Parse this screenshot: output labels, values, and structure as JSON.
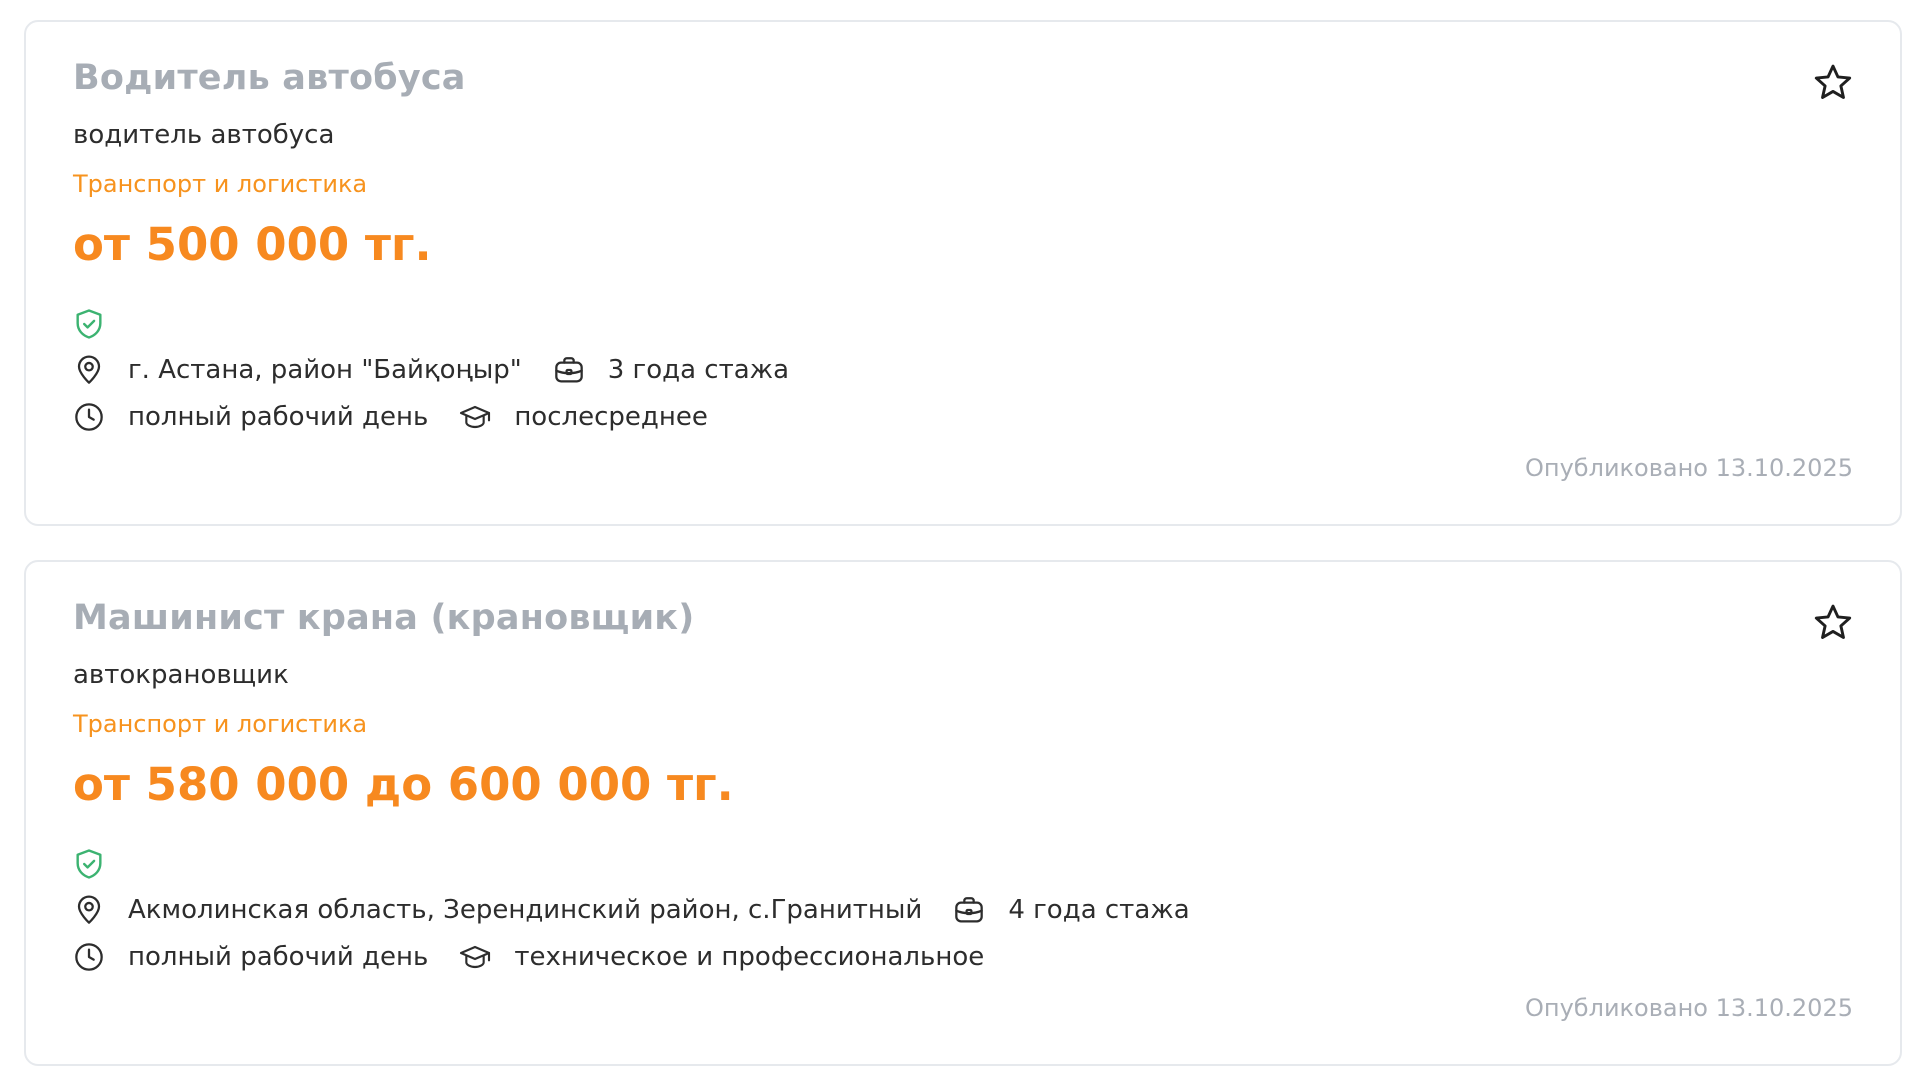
{
  "vacancies": [
    {
      "title": "Водитель автобуса",
      "subtitle": "водитель автобуса",
      "category": "Транспорт и логистика",
      "salary": "от 500 000 тг.",
      "location": "г. Астана, район \"Байқоңыр\"",
      "experience": "3 года стажа",
      "schedule": "полный рабочий день",
      "education": "послесреднее",
      "published": "Опубликовано 13.10.2025"
    },
    {
      "title": "Машинист крана (крановщик)",
      "subtitle": "автокрановщик",
      "category": "Транспорт и логистика",
      "salary": "от 580 000 до 600 000 тг.",
      "location": "Акмолинская область, Зерендинский район, с.Гранитный",
      "experience": "4 года стажа",
      "schedule": "полный рабочий день",
      "education": "техническое и профессиональное",
      "published": "Опубликовано 13.10.2025"
    }
  ],
  "icons": {
    "verified": "shield-check-icon",
    "location": "map-pin-icon",
    "experience": "briefcase-icon",
    "schedule": "clock-icon",
    "education": "graduation-cap-icon",
    "favorite": "star-outline-icon"
  },
  "colors": {
    "title": "#a7adb5",
    "accent": "#f7891f",
    "category": "#f7931e",
    "verified": "#3cb371",
    "text": "#2d2d2d",
    "muted": "#a9aeb6",
    "border": "#e6e9ed"
  }
}
